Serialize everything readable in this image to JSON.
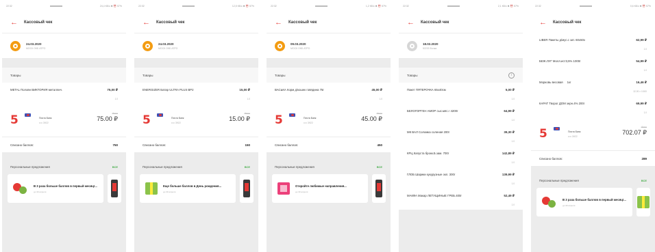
{
  "common": {
    "header_title": "Кассовый чек",
    "goods_label": "Товары",
    "points_label": "Списано баллов:",
    "offers_label": "Персональные предложения",
    "offers_all": "ВСЕ",
    "bank": "Почта Банк",
    "card_mask": "•••• 3922",
    "offer_until": "до 30 апреля"
  },
  "screens": [
    {
      "status_time": "22:32",
      "status_right": "24,4 КБ/с ✱ ⏰ 57%",
      "store_date": "24.03.2020",
      "store_addr": "МОСК ОКБ АТРО",
      "items": [
        {
          "name": "METAL Половн ВИКТОРИЯ металлич.",
          "price": "75,00 ₽",
          "sub": "1.0"
        }
      ],
      "old_total": "Итого",
      "total": "75.00 ₽",
      "points": "750",
      "offer_title": "В 3 раза больше баллов в первый месяц!...",
      "offer_pic": "coins-icon"
    },
    {
      "status_time": "22:32",
      "status_right": "12,5 КБ/с ✱ ⏰ 57%",
      "store_date": "24.03.2020",
      "store_addr": "МОСК ОКБ АТРО",
      "items": [
        {
          "name": "ENERGIZER Батар ULTRA PLUS BP2",
          "price": "15,00 ₽",
          "sub": "1.0"
        }
      ],
      "old_total": "Итого",
      "total": "15.00 ₽",
      "points": "150",
      "offer_title": "Еще больше баллов в День рождения...",
      "offer_pic": "gift-icon"
    },
    {
      "status_time": "22:32",
      "status_right": "1,2 КБ/с ✱ ⏰ 57%",
      "store_date": "09.03.2020",
      "store_addr": "МОСК ОКБ АТРО",
      "items": [
        {
          "name": "ВАСЬКА Корм д/кошек говядина 75г",
          "price": "45,00 ₽",
          "sub": "1.0"
        }
      ],
      "old_total": "Итого",
      "total": "45.00 ₽",
      "points": "450",
      "offer_title": "Откройте любимые направления...",
      "offer_pic": "sale-icon"
    },
    {
      "status_time": "22:32",
      "status_right": "2,1 КБ/с ✱ ⏰ 57%",
      "store_date": "18.02.2020",
      "store_addr": "52233 Бочка",
      "items": [
        {
          "name": "Пакет ПЯТЕРОЧКА 65х40см",
          "price": "5,00 ₽",
          "sub": "1.0"
        },
        {
          "name": "БЕЛОГОРГЕН АМОР сыс.мяс.г 4200г",
          "price": "64,99 ₽",
          "sub": "1.0"
        },
        {
          "name": "МК ВАЛ Соломка соленая 200г",
          "price": "39,30 ₽",
          "sub": "1.0"
        },
        {
          "name": "КРЦ Капуста брокк.Б.зам. 700г",
          "price": "142,89 ₽",
          "sub": "1.0"
        },
        {
          "name": "ГЛОБ Шарики кукурузные окл. 300г",
          "price": "139,99 ₽",
          "sub": "1.0"
        },
        {
          "name": "МАКФА Макар ЛЕТУЩИНЫЕ ГРЕБ.400г",
          "price": "52,49 ₽",
          "sub": "1.0"
        }
      ]
    },
    {
      "status_time": "22:32",
      "status_right": "0,6 КБ/с ✱ ⏰ 57%",
      "items": [
        {
          "name": "LIBER Пакеты д/мус.с зат. 60х50х",
          "price": "62,99 ₽",
          "sub": "1.0"
        },
        {
          "name": "БЕЖ.ЛУГ Молл.ист3,5% 1000г",
          "price": "54,99 ₽",
          "sub": "1.0"
        },
        {
          "name": "Морковь весовая",
          "qty": "1кг",
          "price": "16,46 ₽",
          "sub": "32,90 × 0.500"
        },
        {
          "name": "КАРАТ Творог ДОМ зерн.4% 200г",
          "price": "69,99 ₽",
          "sub": "1.0"
        }
      ],
      "old_total": "Итого",
      "total": "702.07 ₽",
      "points": "289",
      "offer_title": "В 3 раза больше баллов в первый месяц!...",
      "offer_pic": "coins-icon"
    }
  ]
}
